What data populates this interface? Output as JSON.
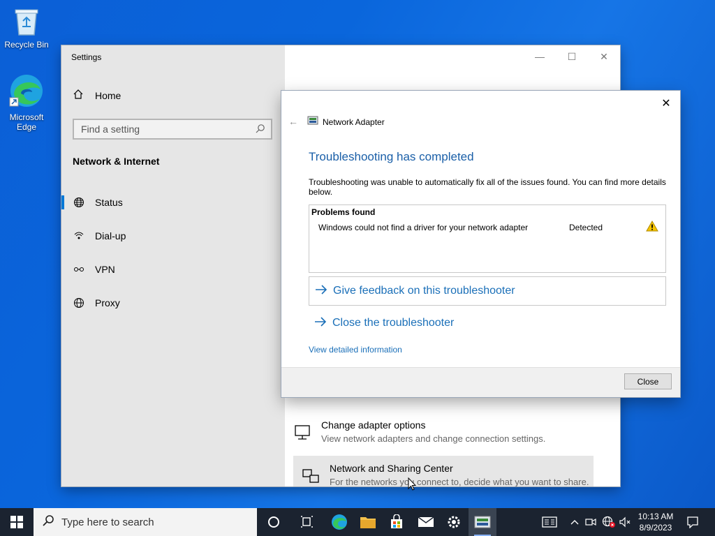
{
  "desktop": {
    "recycle_bin": "Recycle Bin",
    "edge_line1": "Microsoft",
    "edge_line2": "Edge"
  },
  "settings": {
    "title": "Settings",
    "home": "Home",
    "search_placeholder": "Find a setting",
    "section": "Network & Internet",
    "nav": [
      "Status",
      "Dial-up",
      "VPN",
      "Proxy"
    ],
    "right_items": [
      {
        "title": "Change adapter options",
        "desc": "View network adapters and change connection settings."
      },
      {
        "title": "Network and Sharing Center",
        "desc": "For the networks you connect to, decide what you want to share."
      }
    ]
  },
  "dialog": {
    "app_name": "Network Adapter",
    "heading": "Troubleshooting has completed",
    "description": "Troubleshooting was unable to automatically fix all of the issues found. You can find more details below.",
    "problems_header": "Problems found",
    "problem": {
      "text": "Windows could not find a driver for your network adapter",
      "status": "Detected"
    },
    "action_feedback": "Give feedback on this troubleshooter",
    "action_close": "Close the troubleshooter",
    "details_link": "View detailed information",
    "close_button": "Close"
  },
  "taskbar": {
    "search_placeholder": "Type here to search",
    "time": "10:13 AM",
    "date": "8/9/2023"
  },
  "colors": {
    "accent": "#0078d7",
    "link": "#1a6fb8",
    "heading": "#1a5fa8",
    "warning": "#f5c400",
    "taskbar": "#1b2330"
  }
}
